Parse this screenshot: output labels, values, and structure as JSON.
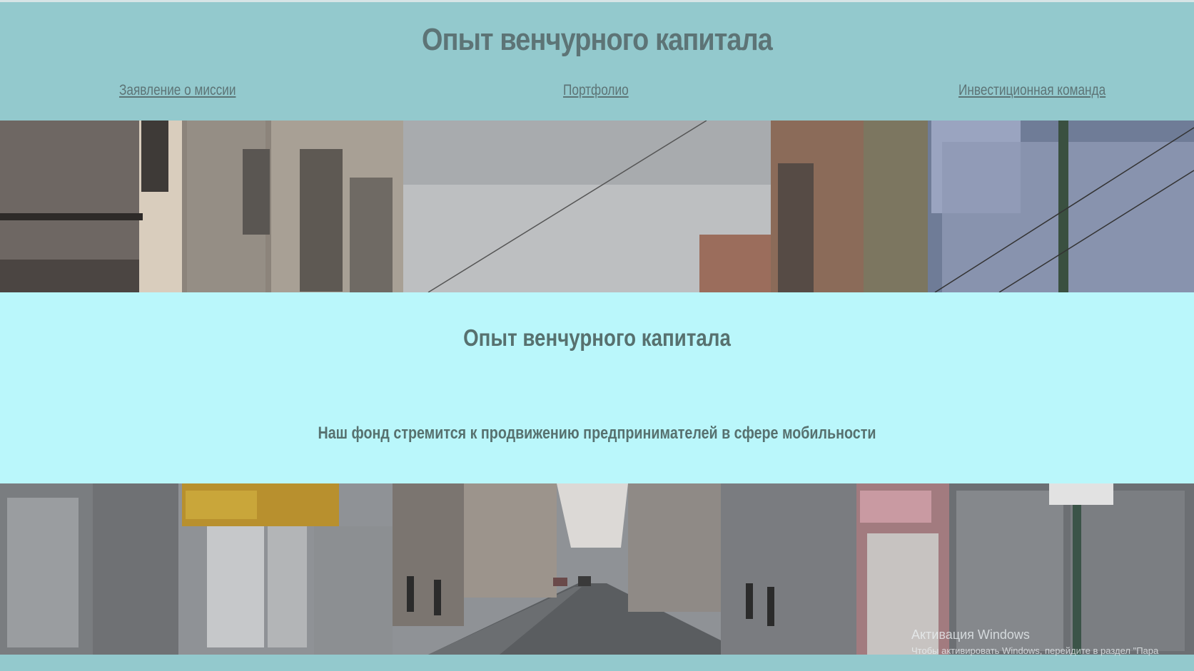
{
  "header": {
    "title": "Опыт венчурного капитала",
    "nav": {
      "mission": "Заявление о миссии",
      "portfolio": "Портфолио",
      "team": "Инвестиционная команда"
    }
  },
  "images": {
    "top": "street-buildings-sky-photo",
    "bottom": "street-shops-shutters-photo"
  },
  "main": {
    "title": "Опыт венчурного капитала",
    "subtitle": "Наш фонд стремится к продвижению предпринимателей в сфере мобильности"
  },
  "watermark": {
    "title": "Активация Windows",
    "subtitle": "Чтобы активировать Windows, перейдите в раздел \"Пара"
  },
  "colors": {
    "header_bg": "#93c9cd",
    "section_bg": "#baf7fb",
    "text": "#5d7476"
  }
}
